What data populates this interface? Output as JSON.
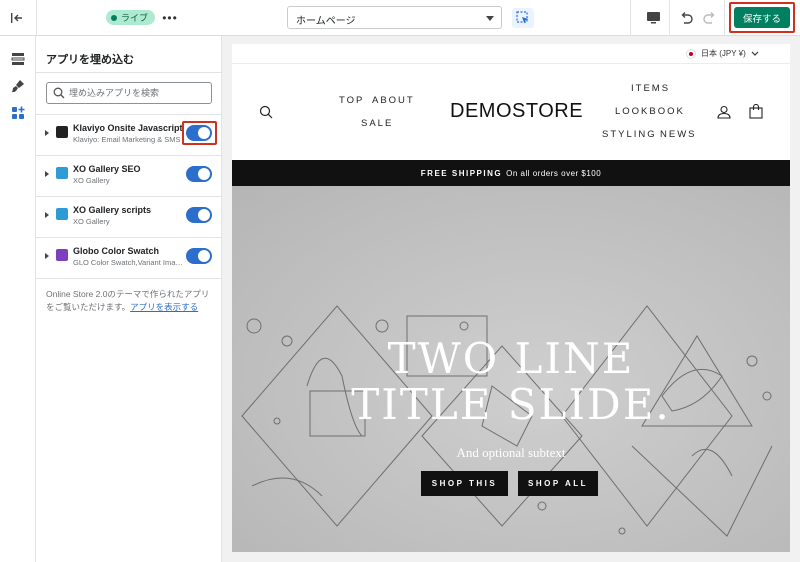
{
  "topbar": {
    "live_badge": "ライブ",
    "more_label": "•••",
    "page_select_value": "ホームページ",
    "save_label": "保存する"
  },
  "sidebar": {
    "title": "アプリを埋め込む",
    "search_placeholder": "埋め込みアプリを検索",
    "apps": [
      {
        "name": "Klaviyo Onsite Javascript",
        "subtitle": "Klaviyo: Email Marketing & SMS",
        "enabled": true,
        "icon_color": "#222222"
      },
      {
        "name": "XO Gallery SEO",
        "subtitle": "XO Gallery",
        "enabled": true,
        "icon_color": "#2f9bd6"
      },
      {
        "name": "XO Gallery scripts",
        "subtitle": "XO Gallery",
        "enabled": true,
        "icon_color": "#2f9bd6"
      },
      {
        "name": "Globo Color Swatch",
        "subtitle": "GLO Color Swatch,Variant Image",
        "enabled": true,
        "icon_color": "#7b3fbf"
      }
    ],
    "note_text": "Online Store 2.0のテーマで作られたアプリをご覧いただけます。",
    "note_link": "アプリを表示する"
  },
  "preview": {
    "language": "日本 (JPY ¥)",
    "nav_left": [
      "TOP",
      "ABOUT",
      "SALE"
    ],
    "logo": "DEMOSTORE",
    "nav_right": [
      "ITEMS",
      "LOOKBOOK",
      "STYLING",
      "NEWS"
    ],
    "shipping_bold": "FREE SHIPPING",
    "shipping_rest": "On all orders over $100",
    "hero": {
      "title_line1": "TWO LINE",
      "title_line2": "TITLE SLIDE.",
      "subtitle": "And optional subtext",
      "button1": "SHOP THIS",
      "button2": "SHOP ALL"
    }
  },
  "colors": {
    "accent": "#008060",
    "toggle": "#2c6ecb",
    "highlight": "#d0311f"
  }
}
